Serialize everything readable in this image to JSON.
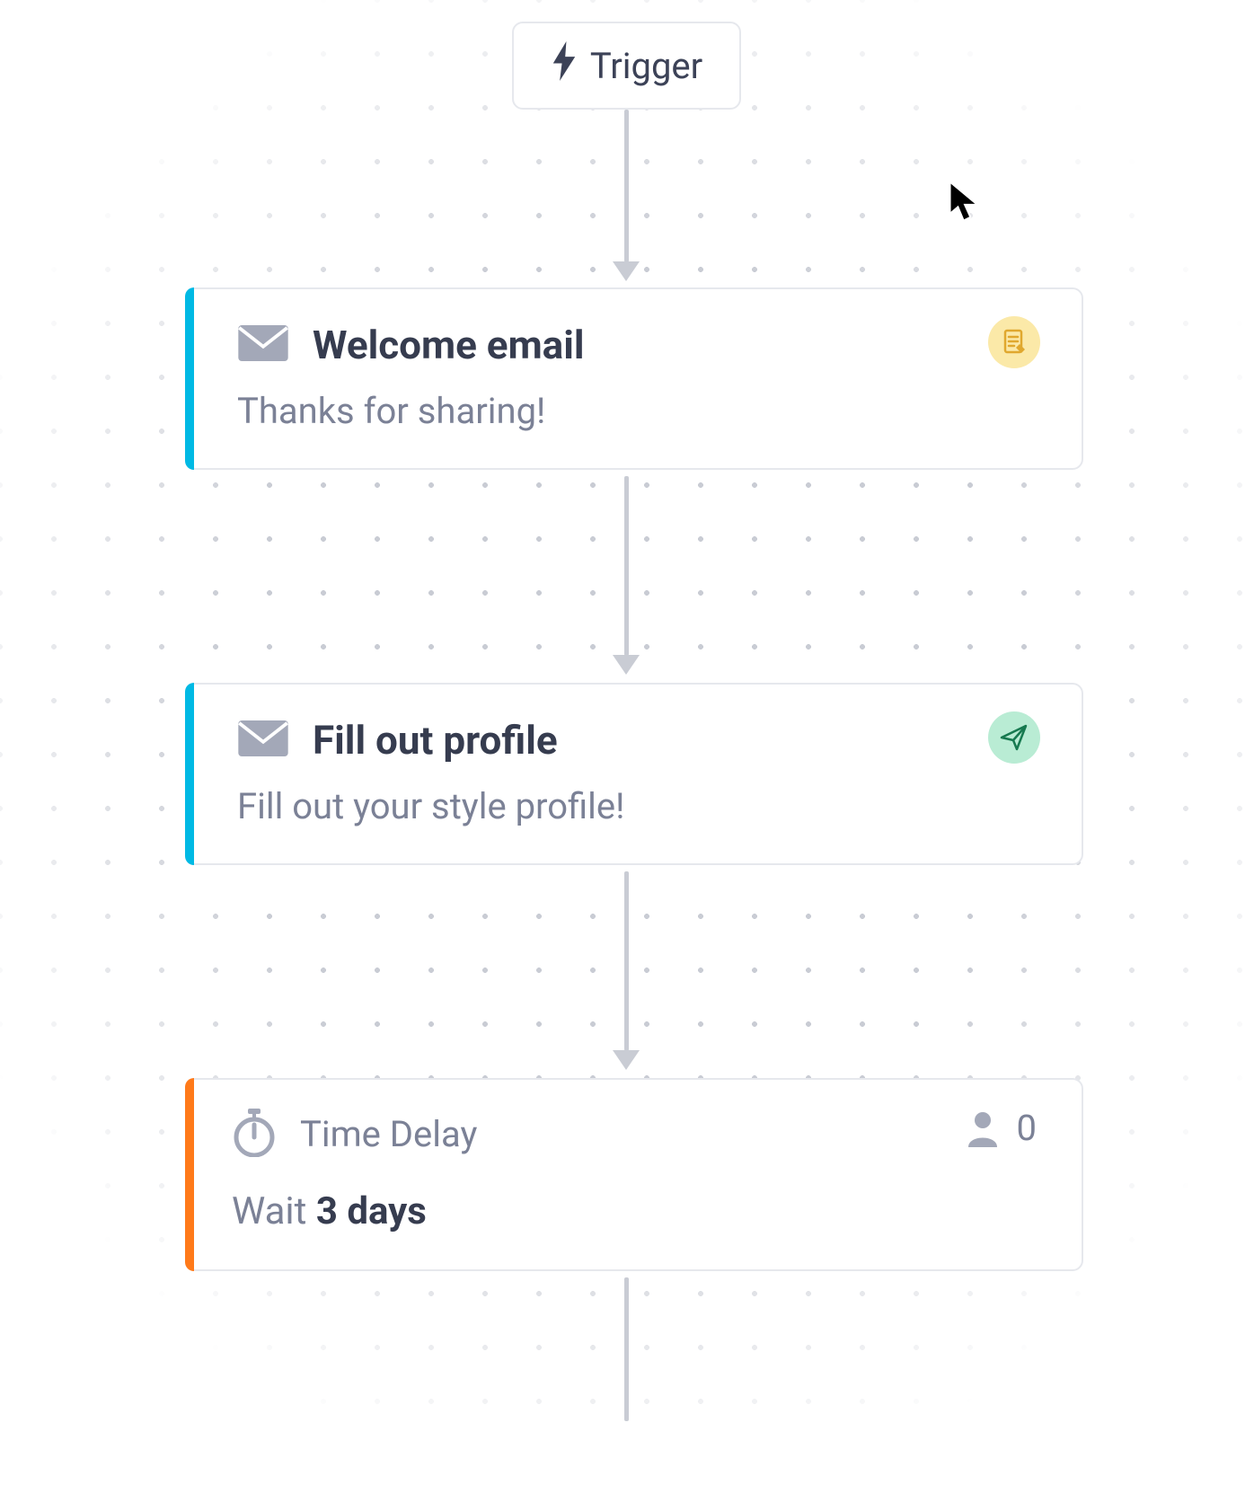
{
  "trigger": {
    "label": "Trigger"
  },
  "nodes": [
    {
      "title": "Welcome email",
      "subtitle": "Thanks for sharing!",
      "stripe_color": "#00b9e4",
      "badge": "draft"
    },
    {
      "title": "Fill out profile",
      "subtitle": "Fill out your style profile!",
      "stripe_color": "#00b9e4",
      "badge": "sent"
    }
  ],
  "delay": {
    "label": "Time Delay",
    "wait_prefix": "Wait",
    "wait_value": "3 days",
    "count": "0",
    "stripe_color": "#ff7a1a"
  }
}
